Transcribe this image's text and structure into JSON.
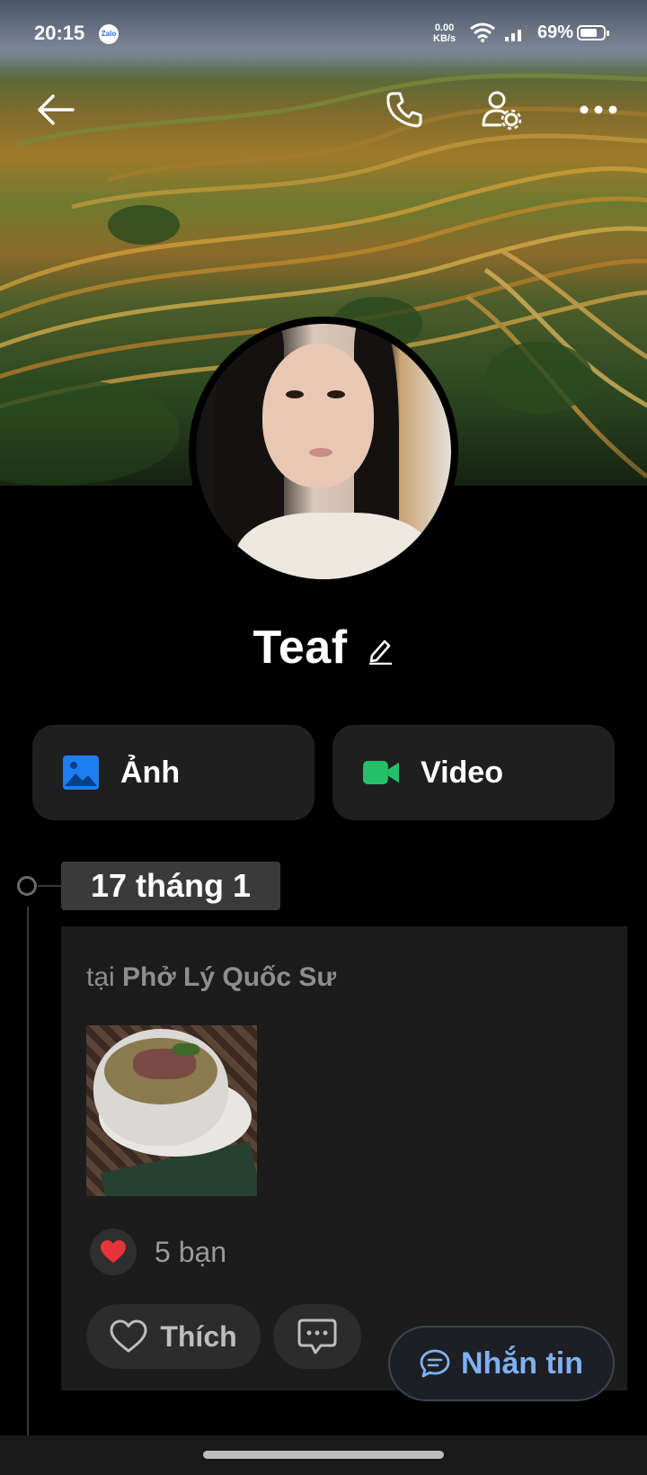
{
  "status_bar": {
    "time": "20:15",
    "notification_app": "Zalo",
    "net_speed_value": "0.00",
    "net_speed_unit": "KB/s",
    "battery_pct": "69%"
  },
  "profile": {
    "name": "Teaf"
  },
  "media": {
    "photo_label": "Ảnh",
    "video_label": "Video"
  },
  "timeline": {
    "date": "17 tháng 1",
    "post": {
      "location_prefix": "tại ",
      "location_name": "Phở Lý Quốc Sư",
      "reaction_count": "5 bạn",
      "like_label": "Thích"
    }
  },
  "message_button": {
    "label": "Nhắn tin"
  },
  "colors": {
    "background": "#000000",
    "card": "#1f1f1f",
    "accent_blue": "#7fb1f5",
    "photo_icon": "#1e7ef0",
    "video_icon": "#23c06a",
    "heart": "#e8323c"
  },
  "icons": [
    "back-arrow-icon",
    "phone-icon",
    "user-settings-icon",
    "more-icon",
    "edit-pencil-icon",
    "photo-icon",
    "video-camera-icon",
    "heart-icon",
    "comment-icon",
    "chat-bubble-icon",
    "wifi-icon",
    "signal-icon",
    "battery-icon"
  ]
}
